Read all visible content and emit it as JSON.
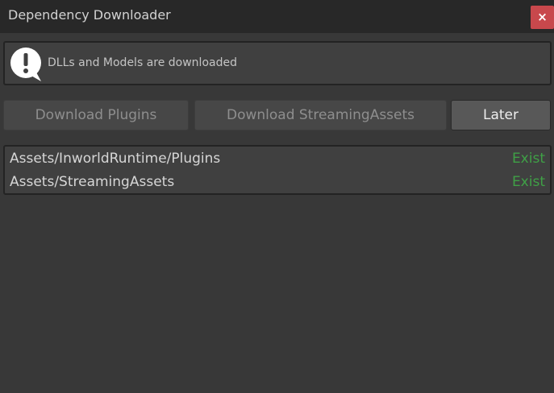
{
  "window": {
    "title": "Dependency Downloader",
    "close_label": "×"
  },
  "help": {
    "icon": "info-bubble-icon",
    "message": "DLLs and Models are downloaded"
  },
  "buttons": {
    "download_plugins": "Download Plugins",
    "download_streaming_assets": "Download StreamingAssets",
    "later": "Later"
  },
  "paths": [
    {
      "path": "Assets/InworldRuntime/Plugins",
      "status": "Exist"
    },
    {
      "path": "Assets/StreamingAssets",
      "status": "Exist"
    }
  ],
  "colors": {
    "status_ok": "#3fa046",
    "close_button": "#c8484c"
  }
}
